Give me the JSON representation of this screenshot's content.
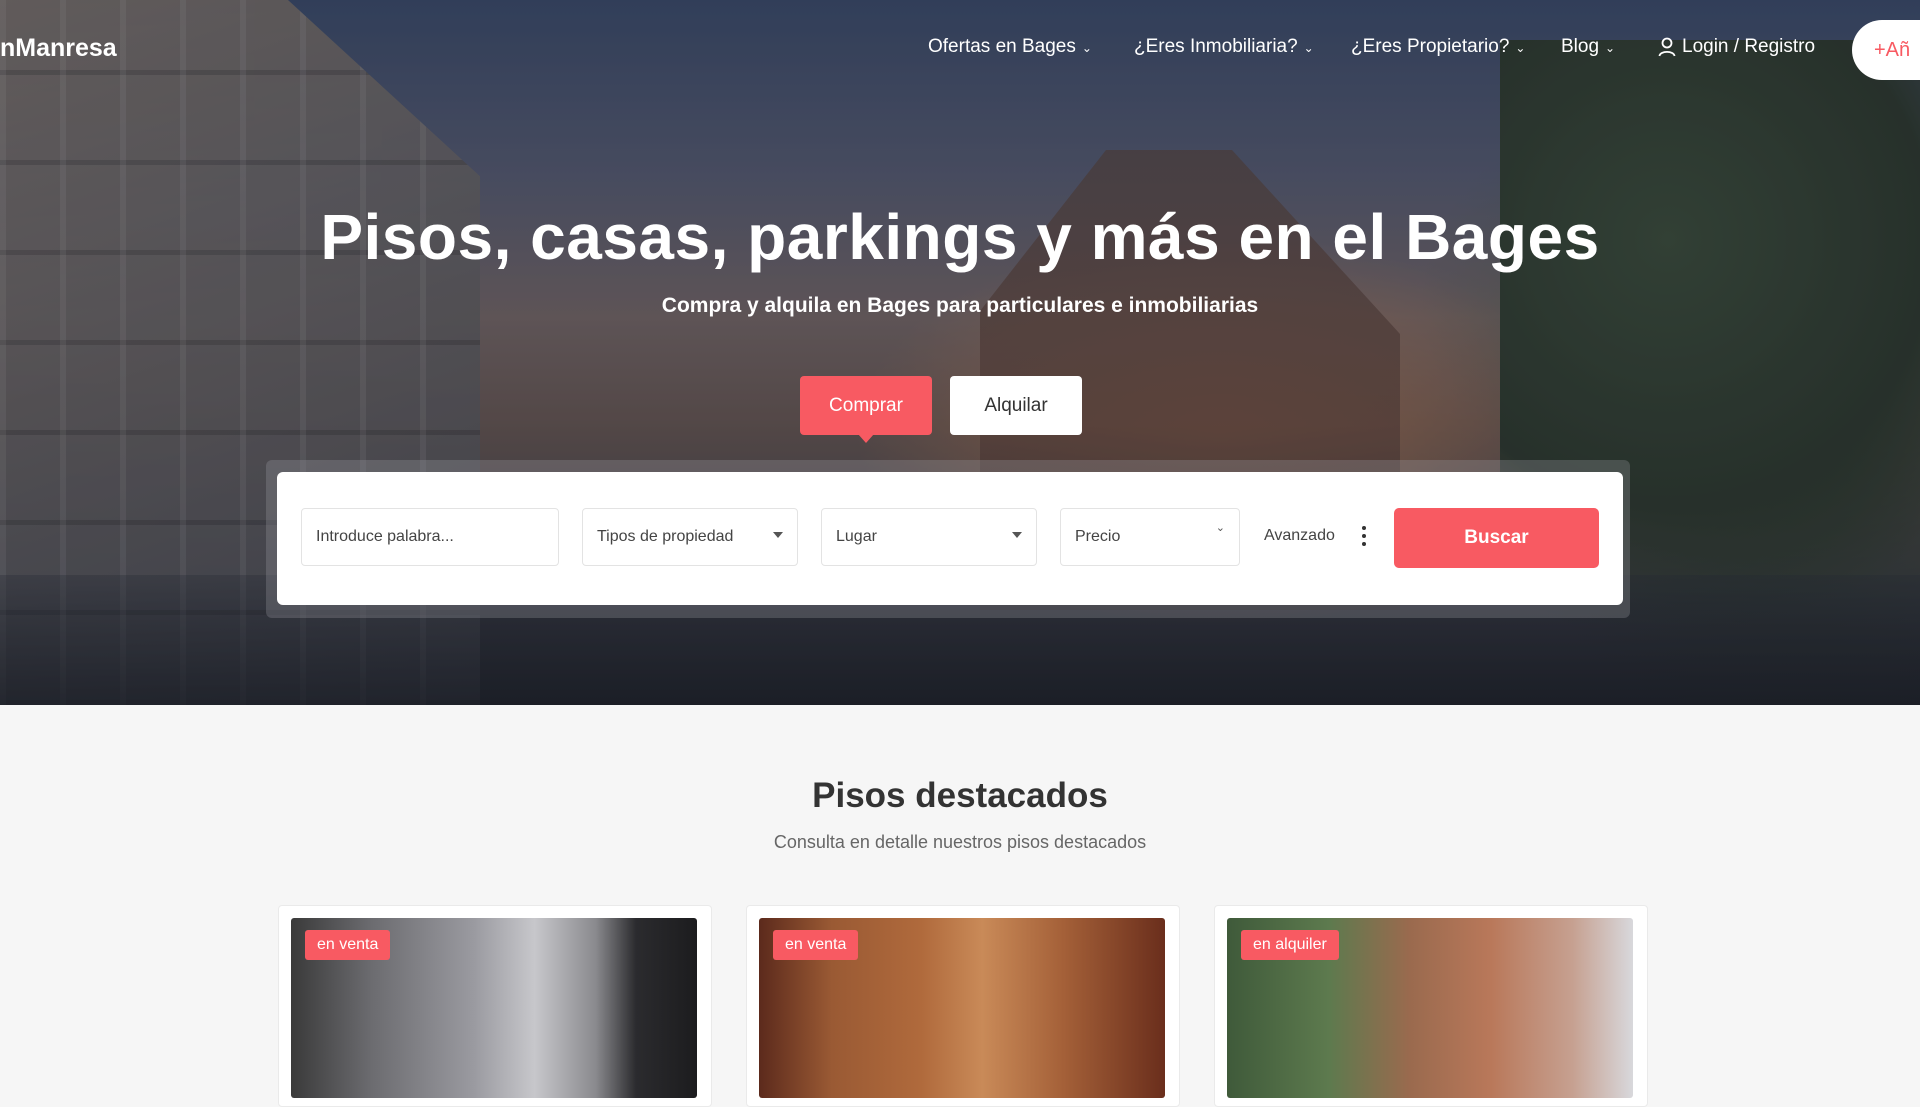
{
  "brand": {
    "logo_text": "nManresa",
    "accent": "#f85a62"
  },
  "nav": {
    "items": [
      {
        "label": "Ofertas en Bages",
        "icon": "chevron-down-icon"
      },
      {
        "label": "¿Eres Inmobiliaria?",
        "icon": "chevron-down-icon"
      },
      {
        "label": "¿Eres Propietario?",
        "icon": "chevron-down-icon"
      },
      {
        "label": "Blog",
        "icon": "chevron-down-icon"
      }
    ],
    "login": {
      "label": "Login / Registro",
      "icon": "user-icon"
    },
    "add_button": {
      "label": "+Añ",
      "icon": "plus-icon"
    }
  },
  "hero": {
    "title": "Pisos, casas, parkings y más en el Bages",
    "subtitle": "Compra y alquila en Bages para particulares e inmobiliarias",
    "tabs": {
      "buy": "Comprar",
      "rent": "Alquilar",
      "active": "buy"
    }
  },
  "search": {
    "keyword_placeholder": "Introduce palabra...",
    "property_type": "Tipos de propiedad",
    "location": "Lugar",
    "price": "Precio",
    "advanced": "Avanzado",
    "submit": "Buscar"
  },
  "featured": {
    "title": "Pisos destacados",
    "subtitle": "Consulta en detalle nuestros pisos destacados",
    "cards": [
      {
        "badge": "en venta"
      },
      {
        "badge": "en venta"
      },
      {
        "badge": "en alquiler"
      }
    ]
  }
}
